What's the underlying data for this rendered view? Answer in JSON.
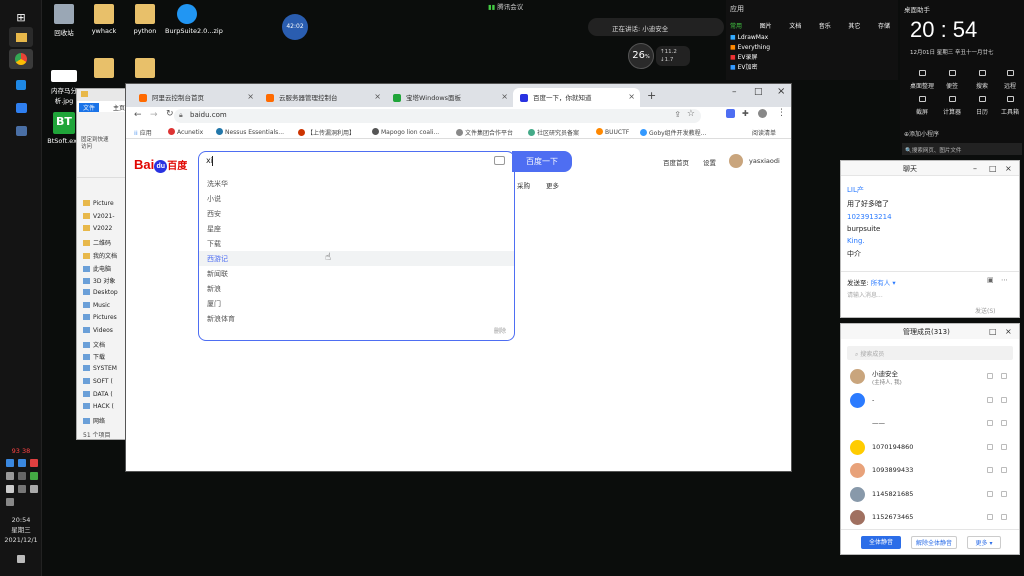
{
  "colors": {
    "accent": "#4e6ef2",
    "baidu_red": "#e10602",
    "baidu_blue": "#2932e1",
    "taskbar": "#141414"
  },
  "taskbar": {
    "time": "20:54",
    "weekday": "星期三",
    "date": "2021/12/1",
    "tray_nums": [
      "93",
      "38"
    ]
  },
  "desktop_icons": [
    {
      "name": "回收站",
      "color": "#9aa7b5"
    },
    {
      "name": "ywhack",
      "color": "#e8c06a"
    },
    {
      "name": "python",
      "color": "#e8c06a"
    },
    {
      "name": "BurpSuite2.0...zip",
      "color": "#2196f3"
    },
    {
      "name": "内存马分析.jpg",
      "color": "#ffffff"
    },
    {
      "name": "BtSoft.exe",
      "color": "#20a53a"
    }
  ],
  "desktop_bt_logo": "BT",
  "circle_widget": "42:02",
  "top": {
    "voice": "腾讯会议",
    "mic_status": "正在讲话: 小迪安全",
    "net_value": "26",
    "net_unit": "%",
    "up": "11.2",
    "down": "1.7"
  },
  "apps_panel": {
    "title": "应用",
    "tabs": [
      "常用",
      "图片",
      "文档",
      "音乐",
      "其它",
      "存储"
    ],
    "items": [
      "LdrawMax",
      "Everything",
      "EV录屏",
      "EV加密"
    ]
  },
  "clock_panel": {
    "title": "桌面助手",
    "time": "20 : 54",
    "date": "12月01日",
    "weekday": "星期三",
    "lunar": "辛丑十一月廿七",
    "grid": [
      "桌面整理",
      "便签",
      "搜索",
      "远程",
      "截屏",
      "计算器",
      "日历",
      "工具箱"
    ],
    "footer": "⊕添加小程序",
    "search": "🔍搜索网页、图片文件"
  },
  "chrome": {
    "tabs": [
      {
        "label": "阿里云控制台首页",
        "fav": "#ff6a00"
      },
      {
        "label": "云服务器管理控制台",
        "fav": "#ff6a00"
      },
      {
        "label": "宝塔Windows面板",
        "fav": "#20a53a"
      },
      {
        "label": "百度一下，你就知道",
        "fav": "#2932e1"
      }
    ],
    "url": "baidu.com",
    "bookmarks": [
      "应用",
      "Acunetix",
      "Nessus Essentials...",
      "【上传漏洞利用】",
      "Mapogo lion coali...",
      "文件集团合作平台",
      "社区研究员备案",
      "BUUCTF",
      "Goby组件开发教程...",
      "阅读清单"
    ]
  },
  "baidu": {
    "logo_bai": "Bai",
    "logo_du": "du",
    "logo_suffix": "百度",
    "query": "xi",
    "button": "百度一下",
    "suggestions": [
      "洗米华",
      "小说",
      "西安",
      "星座",
      "下载",
      "西游记",
      "新闻联",
      "新浪",
      "厦门",
      "新浪体育"
    ],
    "delete": "删除",
    "links": [
      "百度首页",
      "设置"
    ],
    "username": "yasxiaodi",
    "under": [
      "采购",
      "更多"
    ]
  },
  "explorer": {
    "ribbon": [
      "文件",
      "主页"
    ],
    "items": [
      "Picture",
      "V2021-",
      "V2022",
      "二维码",
      "我的文档",
      "此电脑",
      "3D 对象",
      "Desktop",
      "Music",
      "Pictures",
      "Videos",
      "文档",
      "下载",
      "SYSTEM",
      "SOFT (",
      "DATA (",
      "HACK (",
      "网络"
    ],
    "count": "51 个项目",
    "quick": "固定到快速访问"
  },
  "chat": {
    "title": "聊天",
    "lines": [
      "LIL产",
      "用了好多暗了",
      "1023913214",
      "burpsuite",
      "King.",
      "中介"
    ],
    "send_to": "发送至:",
    "recipient": "所有人",
    "placeholder": "请输入消息...",
    "send": "发送(S)"
  },
  "members": {
    "title": "管理成员(313)",
    "search": "搜索成员",
    "people": [
      {
        "name": "小迪安全",
        "sub": "(主持人, 我)",
        "color": "#c9a57d"
      },
      {
        "name": "-",
        "color": "#2b7bff"
      },
      {
        "name": "——",
        "color": "#ffffff"
      },
      {
        "name": "1070194860",
        "color": "#ffcc00"
      },
      {
        "name": "1093899433",
        "color": "#e8a27a"
      },
      {
        "name": "1145821685",
        "color": "#8899aa"
      },
      {
        "name": "1152673465",
        "color": "#a07060"
      }
    ],
    "mute_all": "全体静音",
    "unmute_all": "解除全体静音",
    "more": "更多"
  }
}
